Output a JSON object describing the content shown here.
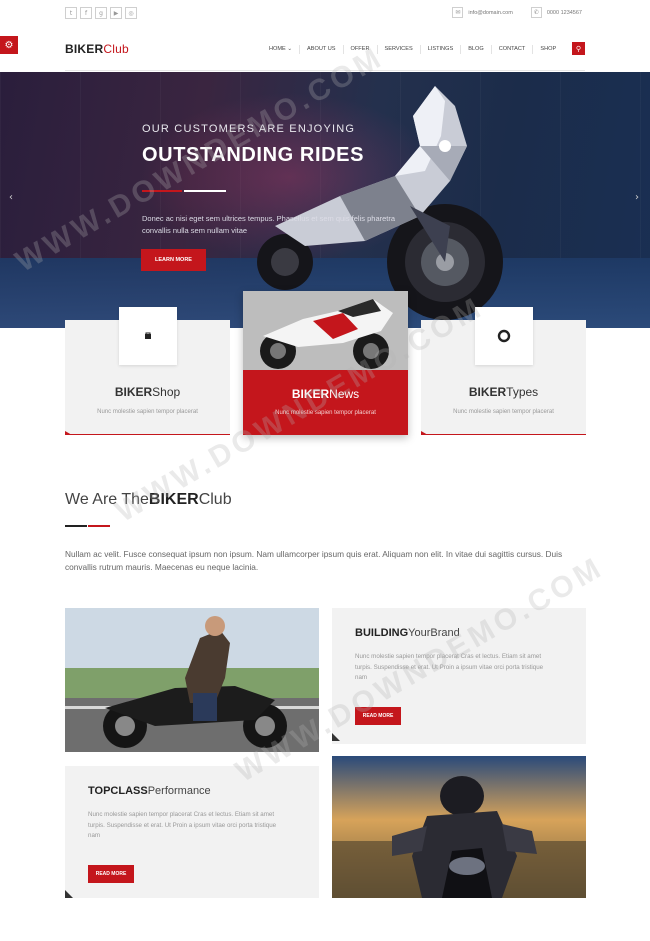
{
  "topbar": {
    "social": [
      {
        "icon": "twitter-icon",
        "glyph": "t"
      },
      {
        "icon": "facebook-icon",
        "glyph": "f"
      },
      {
        "icon": "google-plus-icon",
        "glyph": "g"
      },
      {
        "icon": "youtube-icon",
        "glyph": "▶"
      },
      {
        "icon": "instagram-icon",
        "glyph": "◎"
      }
    ],
    "email": "info@domain.com",
    "phone": "0000 1234567"
  },
  "header": {
    "logo_bold": "BIKER",
    "logo_light": "Club",
    "nav": [
      "HOME ⌄",
      "ABOUT US",
      "OFFER",
      "SERVICES",
      "LISTINGS",
      "BLOG",
      "CONTACT",
      "SHOP"
    ]
  },
  "hero": {
    "tagline": "OUR CUSTOMERS ARE ENJOYING",
    "title": "OUTSTANDING RIDES",
    "description": "Donec ac nisi eget sem ultrices tempus. Phasellus et sem quis felis pharetra convallis nulla sem nullam vitae",
    "button": "LEARN MORE",
    "prev_arrow": "‹",
    "next_arrow": "›"
  },
  "cards": [
    {
      "bold": "BIKER",
      "light": "Shop",
      "subtitle": "Nunc molestie sapien tempor placerat"
    },
    {
      "bold": "BIKER",
      "light": "News",
      "subtitle": "Nunc molestie sapien tempor placerat"
    },
    {
      "bold": "BIKER",
      "light": "Types",
      "subtitle": "Nunc molestie sapien tempor placerat"
    }
  ],
  "about": {
    "title_light": "We Are The",
    "title_bold": "BIKER",
    "title_end": "Club",
    "text": "Nullam ac velit. Fusce consequat ipsum non ipsum. Nam ullamcorper ipsum quis erat. Aliquam non elit. In vitae dui sagittis cursus. Duis convallis rutrum mauris. Maecenas eu neque lacinia."
  },
  "blocks": {
    "building": {
      "bold": "BUILDING",
      "light": "YourBrand",
      "text": "Nunc molestie sapien tempor placerat Cras et lectus. Etiam sit amet turpis. Suspendisse et erat. Ut Proin a ipsum vitae orci porta tristique nam",
      "button": "READ MORE"
    },
    "topclass": {
      "bold": "TOPCLASS",
      "light": "Performance",
      "text": "Nunc molestie sapien tempor placerat Cras et lectus. Etiam sit amet turpis. Suspendisse et erat. Ut Proin a ipsum vitae orci porta tristique nam",
      "button": "READ MORE"
    }
  },
  "watermark": "WWW.DOWNDEMO.COM",
  "colors": {
    "accent": "#c4161c",
    "card_bg": "#f2f2f2",
    "text": "#555555"
  }
}
